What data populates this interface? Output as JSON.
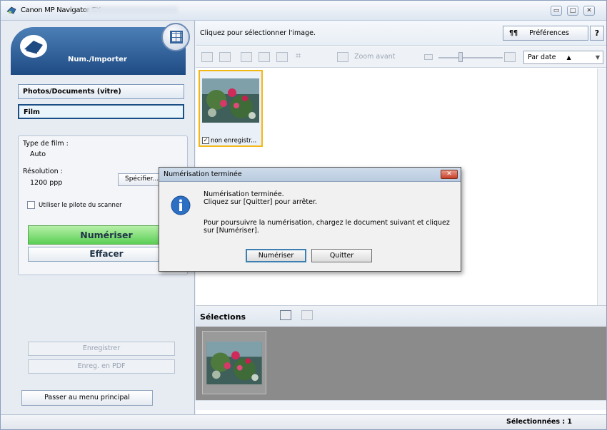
{
  "window": {
    "title": "Canon MP Navigator EX",
    "controls": {
      "minimize": "▭",
      "maximize": "□",
      "close": "✕"
    }
  },
  "left_panel": {
    "header_title": "Num./Importer",
    "mode_buttons": [
      "Photos/Documents (vitre)",
      "Film"
    ],
    "film_type_label": "Type de film :",
    "film_type_value": "Auto",
    "resolution_label": "Résolution :",
    "resolution_value": "1200 ppp",
    "specify_button": "Spécifier...",
    "use_driver_label": "Utiliser le pilote du scanner",
    "scan_button": "Numériser",
    "clear_button": "Effacer",
    "save_button": "Enregistrer",
    "save_pdf_button": "Enreg. en PDF",
    "main_menu_button": "Passer au menu principal"
  },
  "right_panel": {
    "instruction": "Cliquez pour sélectionner l'image.",
    "preferences_button": "Préférences",
    "help_button": "?",
    "zoom_label": "Zoom avant",
    "sort_label": "Par date",
    "sort_arrow": "▲",
    "thumbnail_caption": "non enregistr...",
    "selections_label": "Sélections"
  },
  "status": {
    "selected": "Sélectionnées : 1"
  },
  "dialog": {
    "title": "Numérisation terminée",
    "close": "✕",
    "line1": "Numérisation terminée.",
    "line2": "Cliquez sur [Quitter] pour arrêter.",
    "line3": "Pour poursuivre la numérisation, chargez le document suivant et cliquez",
    "line4": "sur [Numériser].",
    "scan_button": "Numériser",
    "quit_button": "Quitter"
  }
}
